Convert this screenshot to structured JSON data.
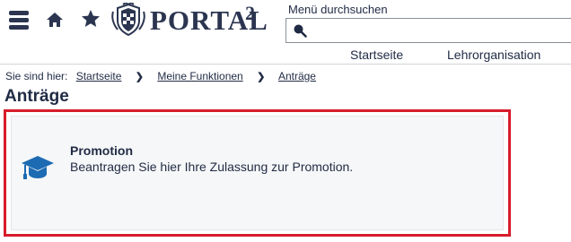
{
  "header": {
    "logo_text": "PORTAL",
    "logo_superscript": "2",
    "search": {
      "label": "Menü durchsuchen",
      "value": ""
    },
    "nav": [
      {
        "label": "Startseite"
      },
      {
        "label": "Lehrorganisation"
      }
    ]
  },
  "breadcrumb": {
    "prefix": "Sie sind hier:",
    "items": [
      {
        "label": "Startseite"
      },
      {
        "label": "Meine Funktionen"
      },
      {
        "label": "Anträge"
      }
    ]
  },
  "page": {
    "title": "Anträge"
  },
  "cards": [
    {
      "icon": "graduation-cap-icon",
      "title": "Promotion",
      "description": "Beantragen Sie hier Ihre Zulassung zur Promotion."
    }
  ],
  "colors": {
    "text": "#1f2a44",
    "icon_blue": "#1c6bb3",
    "highlight_border": "#d71d2b",
    "card_background": "#f6f7f8"
  }
}
